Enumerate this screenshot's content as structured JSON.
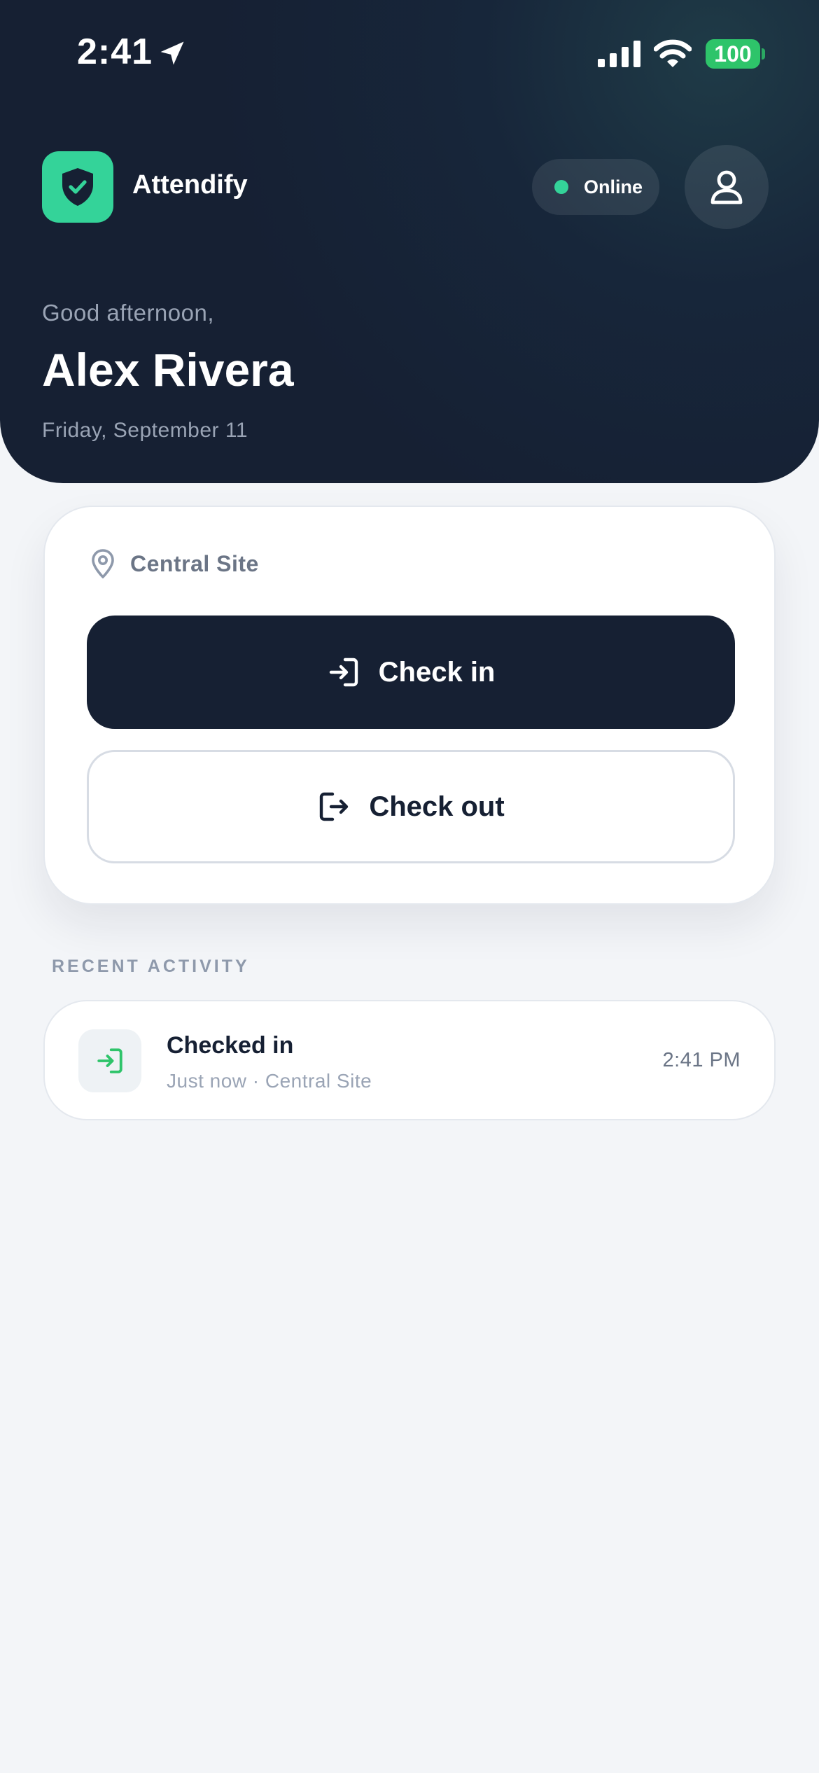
{
  "status_bar": {
    "time": "2:41",
    "battery": "100",
    "icons": [
      "location-arrow-icon",
      "cellular-signal-icon",
      "wifi-icon",
      "battery-icon"
    ]
  },
  "header": {
    "app_name": "Attendify",
    "logo_icon": "shield-check-icon",
    "status_label": "Online",
    "profile_icon": "user-icon",
    "greeting": "Good afternoon,",
    "user_name": "Alex Rivera",
    "date": "Friday, September 11"
  },
  "action_card": {
    "site_icon": "map-pin-icon",
    "site_name": "Central Site",
    "check_in_label": "Check in",
    "check_in_icon": "sign-in-icon",
    "check_out_label": "Check out",
    "check_out_icon": "sign-out-icon"
  },
  "recent_activity": {
    "section_title": "RECENT ACTIVITY",
    "items": [
      {
        "icon": "sign-in-icon",
        "title": "Checked in",
        "subtitle": "Just now · Central Site",
        "time": "2:41 PM"
      }
    ]
  },
  "colors": {
    "header_bg": "#162033",
    "accent": "#34d399",
    "online": "#34d399",
    "battery": "#2ec46a",
    "page_bg": "#f3f5f8"
  }
}
